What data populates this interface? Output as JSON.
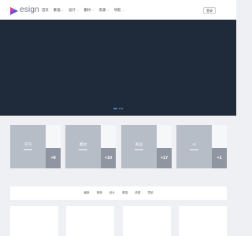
{
  "header": {
    "logo_text": "esign",
    "nav": [
      {
        "label": "首页",
        "has_caret": false
      },
      {
        "label": "素描",
        "has_caret": true
      },
      {
        "label": "设计",
        "has_caret": true
      },
      {
        "label": "素材",
        "has_caret": true
      },
      {
        "label": "资源",
        "has_caret": true
      },
      {
        "label": "导航",
        "has_caret": true
      }
    ],
    "login_label": "登录"
  },
  "hero": {
    "slide_count": 3,
    "active_slide": 1
  },
  "categories": [
    {
      "label": "学习",
      "count": "+8"
    },
    {
      "label": "素材",
      "count": "+10"
    },
    {
      "label": "商业",
      "count": "+17"
    },
    {
      "label": "AI",
      "count": "+1"
    }
  ],
  "filter_tabs": [
    "最新",
    "推荐",
    "设计",
    "素描",
    "资源",
    "导航"
  ],
  "colors": {
    "accent": "#2f8de4",
    "hero_bg": "#1f2a3a",
    "card_bg": "#b7bdc6",
    "count_bg": "#8f96a1"
  },
  "icons": {
    "logo": "design-logo-icon",
    "caret": "chevron-down-icon"
  }
}
